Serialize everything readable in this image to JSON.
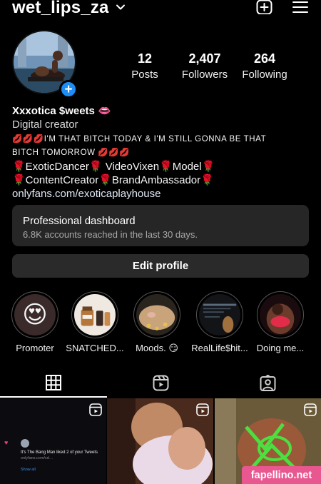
{
  "header": {
    "username": "wet_lips_za",
    "chevron_icon": "chevron-down-icon",
    "new_post_icon": "plus-square-icon",
    "menu_icon": "hamburger-menu-icon"
  },
  "stats": {
    "posts": {
      "count": "12",
      "label": "Posts"
    },
    "followers": {
      "count": "2,407",
      "label": "Followers"
    },
    "following": {
      "count": "264",
      "label": "Following"
    }
  },
  "bio": {
    "display_name": "Xxxotica $weets 👄",
    "category": "Digital creator",
    "line1": "💋💋💋I'M THAT BITCH TODAY & I'M STILL GONNA BE THAT",
    "line2": "BITCH TOMORROW 💋💋💋",
    "line3": "🌹ExoticDancer🌹 VideoVixen🌹Model🌹",
    "line4": "🌹ContentCreator🌹BrandAmbassador🌹",
    "link": "onlyfans.com/exoticaplayhouse"
  },
  "dashboard": {
    "title": "Professional dashboard",
    "subtitle": "6.8K accounts reached in the last 30 days."
  },
  "edit_profile_label": "Edit profile",
  "highlights": [
    {
      "label": "Promoter"
    },
    {
      "label": "SNATCHED..."
    },
    {
      "label": "Moods. 😏"
    },
    {
      "label": "RealLife$hit..."
    },
    {
      "label": "Doing me..."
    }
  ],
  "tabs": [
    {
      "icon": "grid-icon",
      "active": true
    },
    {
      "icon": "reels-icon",
      "active": false
    },
    {
      "icon": "tagged-icon",
      "active": false
    }
  ],
  "tweet_card": {
    "text": "It's The Bang Man liked 2 of your Tweets",
    "meta": "onlyfans.com/cd…",
    "show_all": "Show all"
  },
  "watermark": "fapellino.net",
  "colors": {
    "background": "#000000",
    "badge_blue": "#1e8cf5",
    "card": "#262626",
    "watermark": "#e8578f"
  }
}
